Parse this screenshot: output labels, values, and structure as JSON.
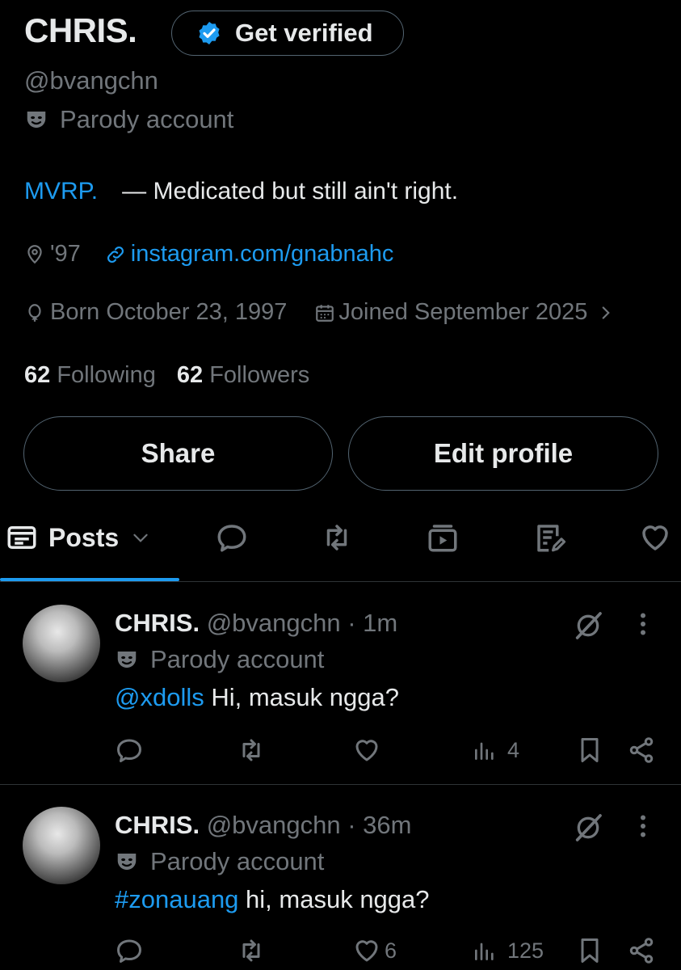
{
  "profile": {
    "name": "CHRIS.",
    "verify_label": "Get verified",
    "handle": "@bvangchn",
    "parody_label": "Parody account",
    "bio_link": "MVRP.",
    "bio_text": "— Medicated but still ain't right.",
    "location": "'97",
    "website": "instagram.com/gnabnahc",
    "birthday": "Born October 23, 1997",
    "joined": "Joined September 2025",
    "following_count": "62",
    "following_label": "Following",
    "followers_count": "62",
    "followers_label": "Followers"
  },
  "buttons": {
    "share": "Share",
    "edit_profile": "Edit profile"
  },
  "tabs": {
    "posts": "Posts"
  },
  "colors": {
    "accent": "#1d9bf0",
    "muted": "#71767b",
    "border": "#2f3336"
  },
  "posts": [
    {
      "name": "CHRIS.",
      "handle": "@bvangchn",
      "time": "· 1m",
      "parody": "Parody account",
      "mention": "@xdolls",
      "text": " Hi, masuk ngga?",
      "likes": "",
      "views": "4"
    },
    {
      "name": "CHRIS.",
      "handle": "@bvangchn",
      "time": "· 36m",
      "parody": "Parody account",
      "mention": "#zonauang",
      "text": " hi, masuk ngga?",
      "likes": "6",
      "views": "125"
    }
  ]
}
